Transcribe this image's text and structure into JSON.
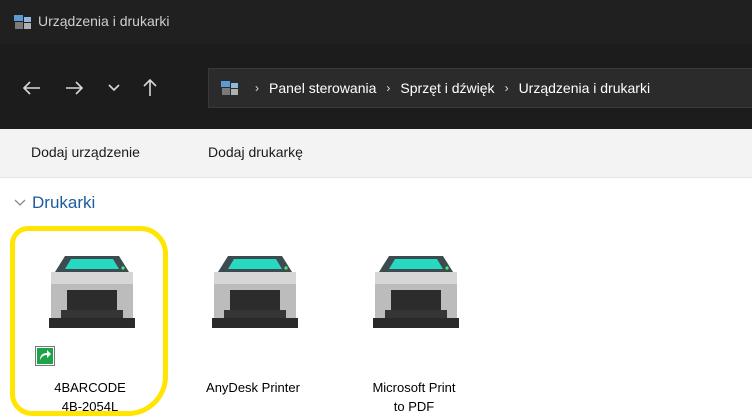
{
  "window": {
    "title": "Urządzenia i drukarki"
  },
  "address_bar": {
    "crumbs": [
      "Panel sterowania",
      "Sprzęt i dźwięk",
      "Urządzenia i drukarki"
    ],
    "separator": "›"
  },
  "toolbar": {
    "add_device_label": "Dodaj urządzenie",
    "add_printer_label": "Dodaj drukarkę"
  },
  "group": {
    "label": "Drukarki"
  },
  "devices": [
    {
      "name_line1": "4BARCODE",
      "name_line2": "4B-2054L",
      "default": true,
      "highlighted": true
    },
    {
      "name_line1": "AnyDesk Printer",
      "name_line2": "",
      "default": false,
      "highlighted": false
    },
    {
      "name_line1": "Microsoft Print",
      "name_line2": "to PDF",
      "default": false,
      "highlighted": false
    }
  ],
  "colors": {
    "highlight": "#ffe500",
    "group_header": "#1a5c9e",
    "titlebar": "#202020"
  }
}
